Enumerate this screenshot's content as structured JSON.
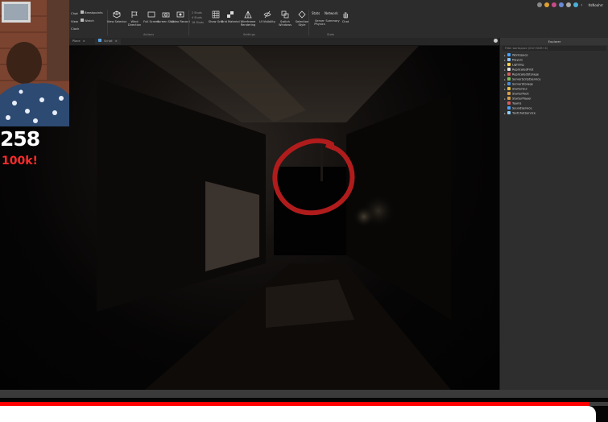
{
  "app": {
    "ribbon": {
      "partial_chat": "Chat",
      "partial_view": "View",
      "partial_clock": "Clock",
      "breakpoints": "Breakpoints",
      "watch": "Watch",
      "buttons": [
        {
          "label": "View Selector",
          "icon": "cube-icon"
        },
        {
          "label": "Wind Direction",
          "icon": "flag-icon"
        },
        {
          "label": "Full Screen",
          "icon": "fullscreen-icon"
        },
        {
          "label": "Screen Shot",
          "icon": "camera-icon"
        },
        {
          "label": "Video Record",
          "icon": "video-icon"
        },
        {
          "label": "Show Grid",
          "icon": "grid-icon"
        },
        {
          "label": "Grid Material",
          "icon": "checker-icon"
        },
        {
          "label": "Wireframe Rendering",
          "icon": "wireframe-icon"
        },
        {
          "label": "UI Visibility",
          "icon": "eye-slash-icon"
        },
        {
          "label": "Switch Windows",
          "icon": "windows-icon"
        },
        {
          "label": "Selection Style",
          "icon": "diamond-icon"
        },
        {
          "label": "Server Physics",
          "icon": "server-icon"
        },
        {
          "label": "Summary",
          "icon": "summary-icon"
        },
        {
          "label": "Chat",
          "icon": "hand-icon"
        }
      ],
      "grid_options": [
        "2 Studs",
        "4 Studs",
        "16 Studs"
      ],
      "stats": "Stats",
      "network": "Network",
      "groups": [
        "Actions",
        "Settings",
        "Stats"
      ]
    },
    "titlebar": {
      "username": "ItsNoahrr"
    },
    "tabs": [
      {
        "label": "Script",
        "icon": "script-icon"
      }
    ],
    "tab_partial": "Place",
    "explorer": {
      "title": "Explorer",
      "filter_placeholder": "Filter workspace (Ctrl+Shift+X)",
      "items": [
        {
          "label": "Workspace",
          "icon": "workspace-icon",
          "color": "#4aa3ff",
          "expandable": true
        },
        {
          "label": "Players",
          "icon": "players-icon",
          "color": "#8ec5ff",
          "expandable": true
        },
        {
          "label": "Lighting",
          "icon": "lighting-icon",
          "color": "#ffd24a",
          "expandable": true
        },
        {
          "label": "ReplicatedFirst",
          "icon": "folder-icon",
          "color": "#e3e3e3",
          "expandable": true
        },
        {
          "label": "ReplicatedStorage",
          "icon": "folder-icon",
          "color": "#d85c5c",
          "expandable": true
        },
        {
          "label": "ServerScriptService",
          "icon": "script-icon",
          "color": "#7fbf5a",
          "expandable": true
        },
        {
          "label": "ServerStorage",
          "icon": "storage-icon",
          "color": "#4a8ed8",
          "expandable": true
        },
        {
          "label": "StarterGui",
          "icon": "gui-icon",
          "color": "#e3c04a",
          "expandable": true
        },
        {
          "label": "StarterPack",
          "icon": "pack-icon",
          "color": "#d8a04a",
          "expandable": false
        },
        {
          "label": "StarterPlayer",
          "icon": "player-icon",
          "color": "#d8a04a",
          "expandable": true
        },
        {
          "label": "Teams",
          "icon": "teams-icon",
          "color": "#d85c5c",
          "expandable": false
        },
        {
          "label": "SoundService",
          "icon": "sound-icon",
          "color": "#4aa3ff",
          "expandable": false
        },
        {
          "label": "TextChatService",
          "icon": "chat-icon",
          "color": "#8fd0ff",
          "expandable": true
        }
      ]
    }
  },
  "stream_overlay": {
    "counter": "258",
    "goal": "100k!"
  },
  "player": {
    "progress": 0.97
  },
  "colors": {
    "annotation_circle": "#b01c1c",
    "progress_red": "#ff0000",
    "goal_red": "#ff2b2b"
  }
}
